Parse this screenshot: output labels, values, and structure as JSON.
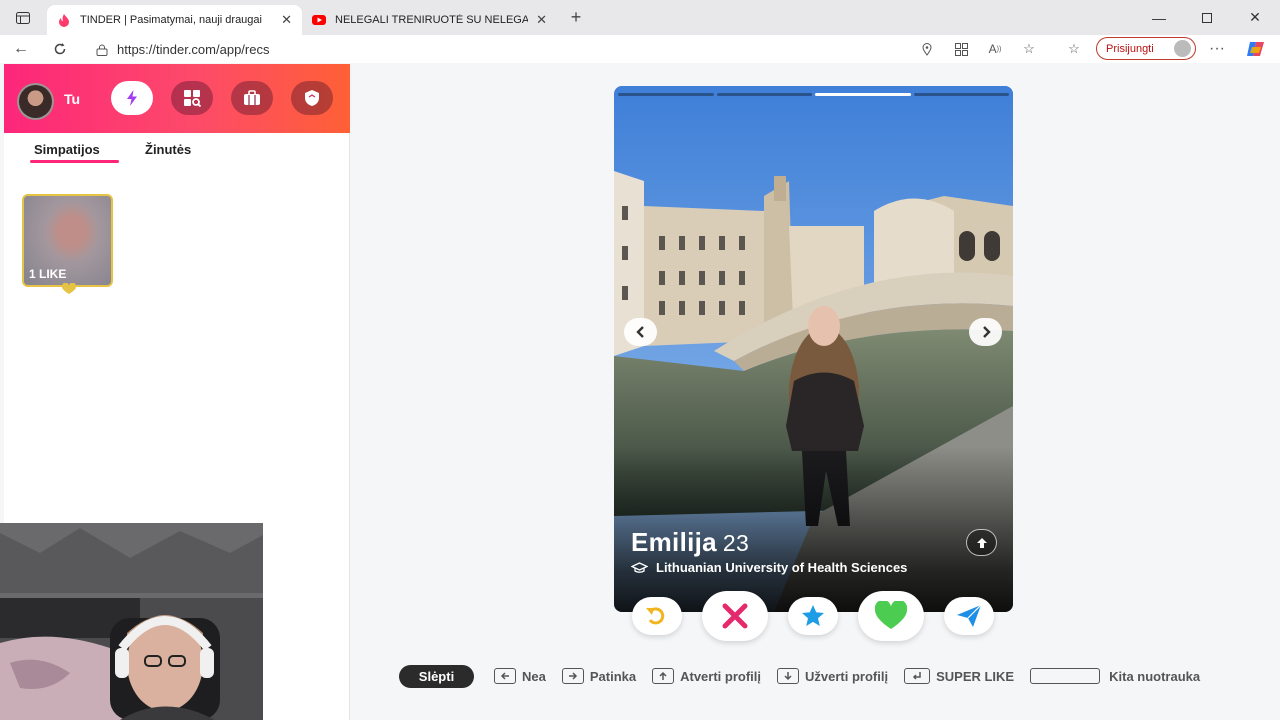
{
  "browser": {
    "tabs": [
      {
        "title": "TINDER | Pasimatymai, nauji draugai",
        "icon": "tinder-flame-icon",
        "active": true
      },
      {
        "title": "NELEGALI TRENIRUOTĖ SU NELEGALIAIS",
        "icon": "youtube-icon",
        "active": false
      }
    ],
    "url": "https://tinder.com/app/recs",
    "signin_label": "Prisijungti"
  },
  "sidebar": {
    "user_label": "Tu",
    "tabs": [
      {
        "label": "Simpatijos",
        "active": true
      },
      {
        "label": "Žinutės",
        "active": false
      }
    ],
    "likes_label": "1 LIKE"
  },
  "profile": {
    "name": "Emilija",
    "age": "23",
    "school": "Lithuanian University of Health Sciences",
    "photo_index": 3,
    "photo_count": 4
  },
  "actions": [
    {
      "name": "rewind-button",
      "icon": "rewind-icon",
      "color": "#f0b51f"
    },
    {
      "name": "nope-button",
      "icon": "x-icon",
      "color": "#e42a6c"
    },
    {
      "name": "super-like-button",
      "icon": "star-icon",
      "color": "#1e9ce6"
    },
    {
      "name": "like-button",
      "icon": "heart-icon",
      "color": "#4ccd52"
    },
    {
      "name": "boost-button",
      "icon": "paper-plane-icon",
      "color": "#1d8fe6"
    }
  ],
  "shortcuts": {
    "hide_label": "Slėpti",
    "items": [
      {
        "label": "Nea",
        "icon": "arrow-left-key-icon"
      },
      {
        "label": "Patinka",
        "icon": "arrow-right-key-icon"
      },
      {
        "label": "Atverti profilį",
        "icon": "arrow-up-key-icon"
      },
      {
        "label": "Užverti profilį",
        "icon": "arrow-down-key-icon"
      },
      {
        "label": "SUPER LIKE",
        "icon": "enter-key-icon"
      },
      {
        "label": "Kita nuotrauka",
        "icon": "space-key-icon"
      }
    ]
  },
  "colors": {
    "brand_gradient_start": "#fd267a",
    "brand_gradient_end": "#ff6036",
    "accent_gold": "#e6c344"
  }
}
